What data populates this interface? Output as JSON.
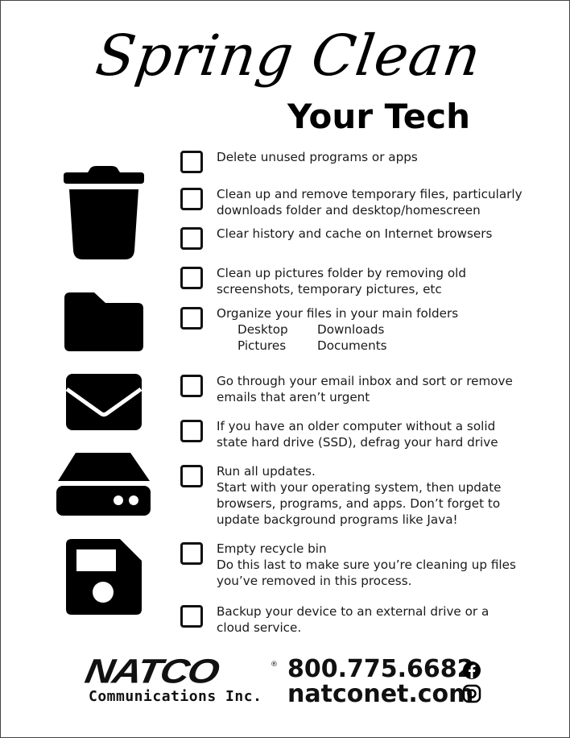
{
  "header": {
    "title_script": "Spring Clean",
    "title_sub": "Your Tech"
  },
  "icons": [
    "trash-icon",
    "folder-icon",
    "envelope-icon",
    "hard-drive-icon",
    "floppy-disk-icon"
  ],
  "checklist": [
    {
      "lines": [
        "Delete unused programs or apps"
      ],
      "checked": false
    },
    {
      "lines": [
        "Clean up and remove temporary files, particularly",
        "downloads folder and desktop/homescreen"
      ],
      "checked": false
    },
    {
      "lines": [
        "Clear history and cache on Internet browsers"
      ],
      "checked": false
    },
    {
      "lines": [
        "Clean up pictures folder by removing old",
        "screenshots, temporary pictures, etc"
      ],
      "checked": false
    },
    {
      "lines": [
        "Organize your files in your main folders"
      ],
      "checked": false,
      "folders": [
        "Desktop",
        "Downloads",
        "Pictures",
        "Documents"
      ]
    },
    {
      "lines": [
        "Go through your email inbox and sort or remove",
        "emails that aren’t urgent"
      ],
      "checked": false
    },
    {
      "lines": [
        "If you have an older computer without a solid",
        "state hard drive (SSD), defrag your hard drive"
      ],
      "checked": false
    },
    {
      "lines": [
        "Run all updates.",
        "Start with your operating system, then update",
        "browsers, programs, and apps. Don’t forget to",
        "update background programs like Java!"
      ],
      "checked": false
    },
    {
      "lines": [
        "Empty recycle bin",
        "Do this last to make sure you’re cleaning up files",
        "you’ve removed in this process."
      ],
      "checked": false
    },
    {
      "lines": [
        "Backup your device to an external drive or a",
        "cloud service."
      ],
      "checked": false
    }
  ],
  "footer": {
    "logo": "NATCO",
    "registered": "®",
    "company": "Communications Inc.",
    "phone": "800.775.6682",
    "website": "natconet.com",
    "social": [
      "facebook-icon",
      "instagram-icon"
    ]
  }
}
